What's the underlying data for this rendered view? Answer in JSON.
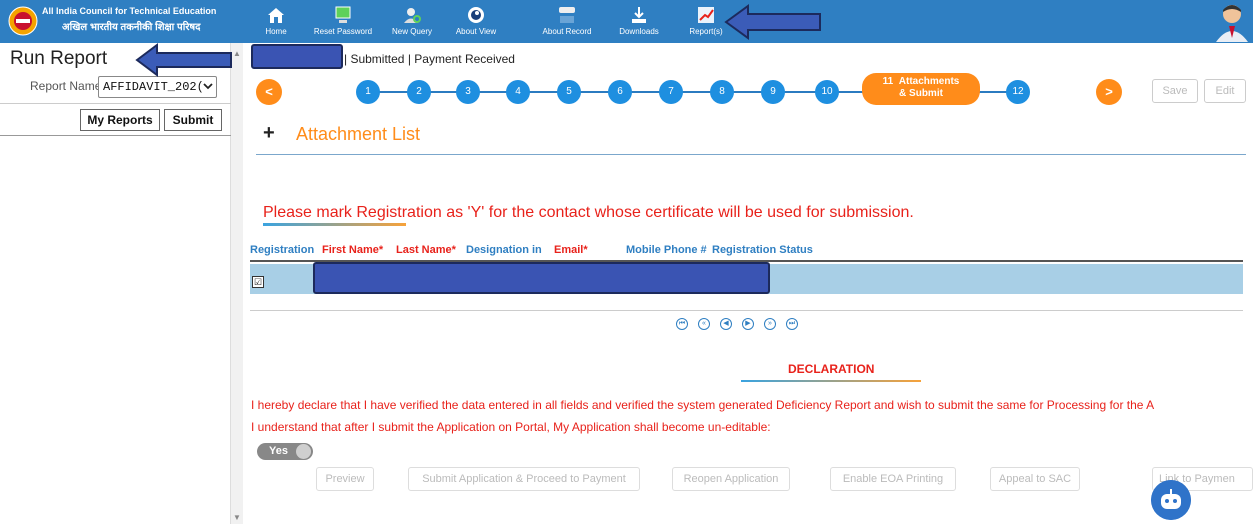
{
  "header": {
    "brand_en": "All India Council for Technical Education",
    "brand_hi": "अखिल भारतीय तकनीकी शिक्षा परिषद",
    "nav": [
      {
        "label": "Home",
        "icon": "home-icon"
      },
      {
        "label": "Reset Password",
        "icon": "monitor-icon"
      },
      {
        "label": "New Query",
        "icon": "user-search-icon"
      },
      {
        "label": "About View",
        "icon": "eye-icon"
      },
      {
        "label": "About Record",
        "icon": "keyboard-icon"
      },
      {
        "label": "Downloads",
        "icon": "download-icon"
      },
      {
        "label": "Report(s)",
        "icon": "report-chart-icon"
      }
    ]
  },
  "left": {
    "title": "Run Report",
    "report_name_label": "Report Name",
    "report_name_value": "AFFIDAVIT_202(",
    "my_reports": "My Reports",
    "submit": "Submit"
  },
  "status_text": "| Submitted | Payment Received",
  "stepper": {
    "prev": "<",
    "next": ">",
    "steps": [
      "1",
      "2",
      "3",
      "4",
      "5",
      "6",
      "7",
      "8",
      "9",
      "10"
    ],
    "active_number": "11",
    "active_line1": "Attachments",
    "active_line2": "& Submit",
    "last": "12",
    "save": "Save",
    "edit": "Edit"
  },
  "attachment": {
    "plus": "+",
    "title": "Attachment List"
  },
  "warning": "Please mark Registration as 'Y' for the contact whose certificate will be used for submission.",
  "table": {
    "headers": [
      {
        "label": "Registration",
        "color": "blue"
      },
      {
        "label": "First Name*",
        "color": "red"
      },
      {
        "label": "Last Name*",
        "color": "red"
      },
      {
        "label": "Designation in",
        "color": "blue"
      },
      {
        "label": "Email*",
        "color": "red"
      },
      {
        "label": "Mobile Phone #",
        "color": "blue"
      },
      {
        "label": "Registration Status",
        "color": "blue"
      }
    ],
    "row_checked": "☑"
  },
  "declaration": {
    "title": "DECLARATION",
    "line1": "I hereby declare that I have verified the data entered in all fields and verified the system generated Deficiency Report and wish to submit the same for Processing for the A",
    "line2": "I understand that after I submit the Application on Portal, My Application shall become un-editable:",
    "toggle": "Yes"
  },
  "bottom_buttons": {
    "preview": "Preview",
    "submit_pay": "Submit Application & Proceed to Payment",
    "reopen": "Reopen Application",
    "eoa": "Enable EOA Printing",
    "appeal": "Appeal to SAC",
    "payment": "Link to Paymen"
  },
  "colors": {
    "topbar": "#2f7fc2",
    "accent_orange": "#ff8c1a",
    "step_blue": "#1e8fe0",
    "warn_red": "#e8221b",
    "annotation_arrow": "#3b5cb8"
  }
}
